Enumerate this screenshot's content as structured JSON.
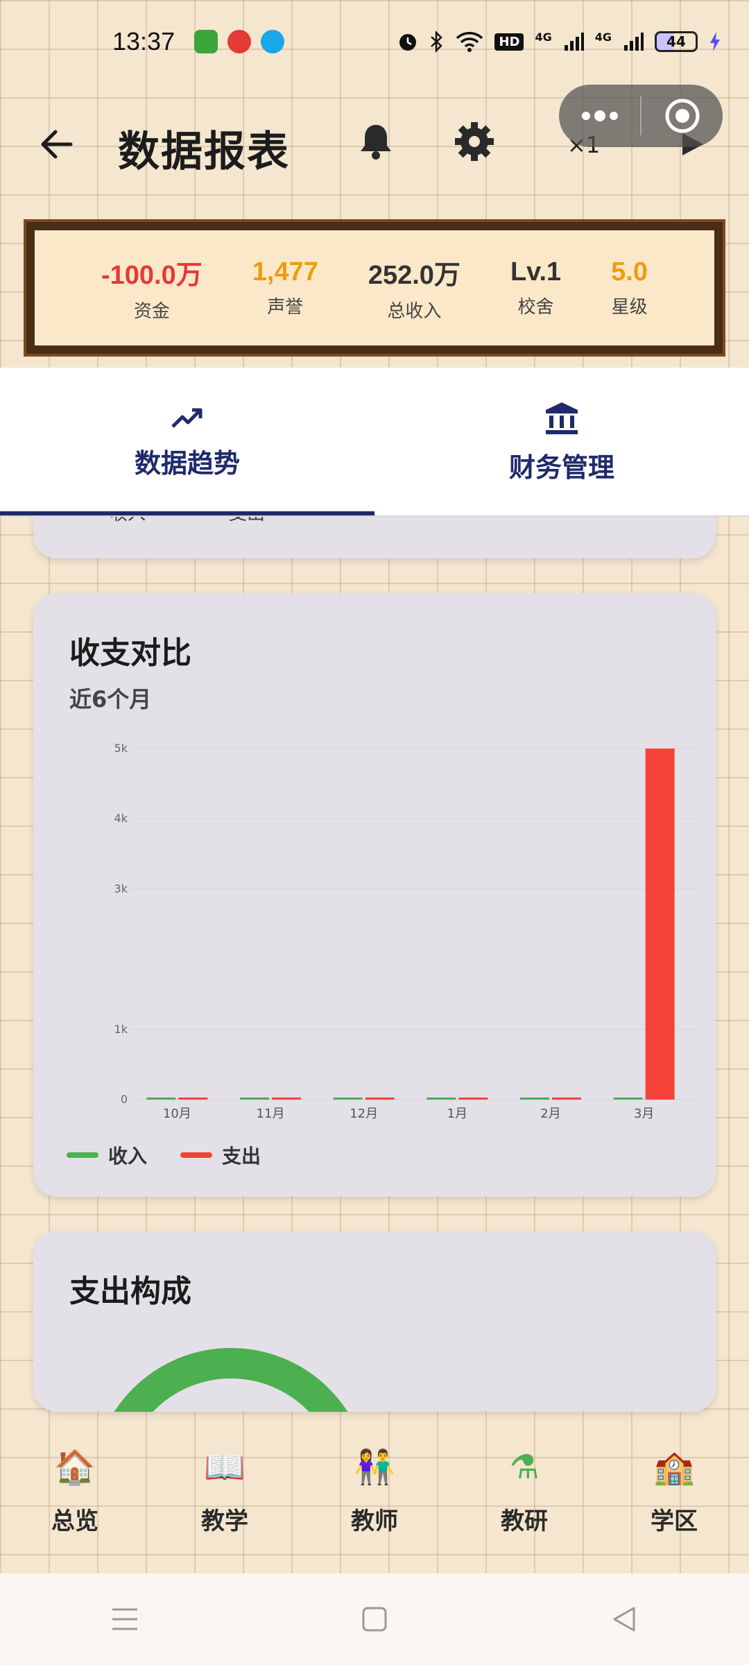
{
  "status_bar": {
    "time": "13:37",
    "network1": "4G",
    "network2": "4G",
    "battery": "44",
    "hd": "HD"
  },
  "header": {
    "title": "数据报表",
    "speed": "×1"
  },
  "stats": [
    {
      "value": "-100.0万",
      "label": "资金",
      "color": "#e53935"
    },
    {
      "value": "1,477",
      "label": "声誉",
      "color": "#f29a12"
    },
    {
      "value": "252.0万",
      "label": "总收入",
      "color": "#333333"
    },
    {
      "value": "Lv.1",
      "label": "校舍",
      "color": "#333333"
    },
    {
      "value": "5.0",
      "label": "星级",
      "color": "#f29a12"
    }
  ],
  "tabs": [
    {
      "label": "数据趋势",
      "icon": "trending-up-icon",
      "active": true
    },
    {
      "label": "财务管理",
      "icon": "bank-icon",
      "active": false
    }
  ],
  "prev_card": {
    "legend": [
      "收入",
      "支出"
    ]
  },
  "chart_card": {
    "title": "收支对比",
    "subtitle": "近6个月"
  },
  "chart_data": {
    "type": "bar",
    "categories": [
      "10月",
      "11月",
      "12月",
      "1月",
      "2月",
      "3月"
    ],
    "series": [
      {
        "name": "收入",
        "color": "#4caf50",
        "values": [
          0,
          0,
          0,
          0,
          0,
          0
        ]
      },
      {
        "name": "支出",
        "color": "#f44336",
        "values": [
          0,
          0,
          0,
          0,
          0,
          5000
        ]
      }
    ],
    "yticks": [
      "0",
      "1k",
      "3k",
      "4k",
      "5k"
    ],
    "ytick_values": [
      0,
      1000,
      3000,
      4000,
      5000
    ],
    "ylim": [
      0,
      5000
    ],
    "legend": "bottom-left",
    "grid": true
  },
  "pie_card": {
    "title": "支出构成"
  },
  "bottom_nav": [
    {
      "label": "总览",
      "icon": "🏠"
    },
    {
      "label": "教学",
      "icon": "📖"
    },
    {
      "label": "教师",
      "icon": "👫"
    },
    {
      "label": "教研",
      "icon": "⚗"
    },
    {
      "label": "学区",
      "icon": "🏫"
    }
  ]
}
